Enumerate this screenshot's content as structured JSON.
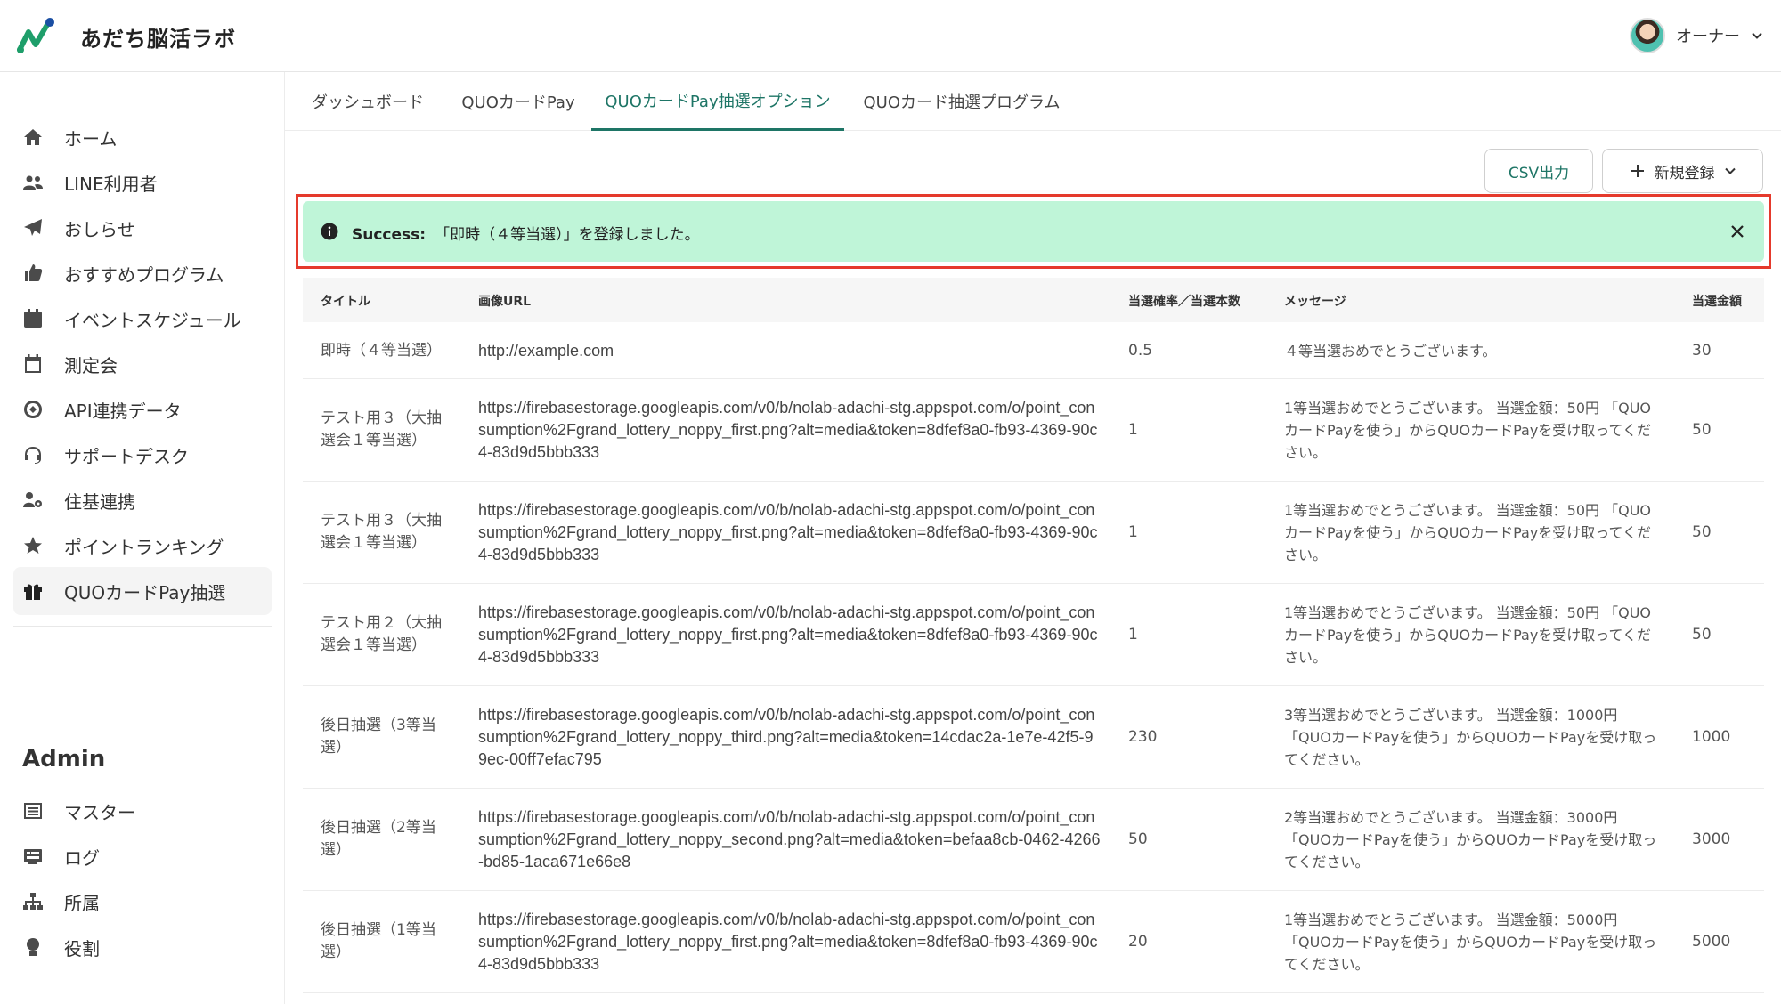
{
  "header": {
    "brand": "あだち脳活ラボ",
    "user_name": "オーナー",
    "colors": {
      "logo_green": "#1e9e6a",
      "logo_blue": "#1a4fa3",
      "accent": "#1e7566"
    }
  },
  "sidebar": {
    "items": [
      {
        "label": "ホーム",
        "icon": "home-icon"
      },
      {
        "label": "LINE利用者",
        "icon": "users-icon"
      },
      {
        "label": "おしらせ",
        "icon": "paper-plane-icon"
      },
      {
        "label": "おすすめプログラム",
        "icon": "thumbs-up-icon"
      },
      {
        "label": "イベントスケジュール",
        "icon": "calendar-icon"
      },
      {
        "label": "測定会",
        "icon": "calendar-blank-icon"
      },
      {
        "label": "API連携データ",
        "icon": "api-icon"
      },
      {
        "label": "サポートデスク",
        "icon": "headset-icon"
      },
      {
        "label": "住基連携",
        "icon": "user-gear-icon"
      },
      {
        "label": "ポイントランキング",
        "icon": "star-icon"
      },
      {
        "label": "QUOカードPay抽選",
        "icon": "gift-icon"
      }
    ],
    "admin_title": "Admin",
    "admin_items": [
      {
        "label": "マスター",
        "icon": "list-icon"
      },
      {
        "label": "ログ",
        "icon": "log-icon"
      },
      {
        "label": "所属",
        "icon": "org-icon"
      },
      {
        "label": "役割",
        "icon": "role-icon"
      }
    ]
  },
  "tabs": [
    "ダッシュボード",
    "QUOカードPay",
    "QUOカードPay抽選オプション",
    "QUOカード抽選プログラム"
  ],
  "actions": {
    "csv": "CSV出力",
    "new": "新規登録"
  },
  "alert": {
    "prefix": "Success:",
    "message": "「即時（４等当選）」を登録しました。",
    "bg_color": "#bff5d8"
  },
  "table": {
    "headers": [
      "タイトル",
      "画像URL",
      "当選確率／当選本数",
      "メッセージ",
      "当選金額"
    ],
    "rows": [
      {
        "title": "即時（４等当選）",
        "url": "http://example.com",
        "prob": "0.5",
        "message": "４等当選おめでとうございます。",
        "amount": "30"
      },
      {
        "title": "テスト用３（大抽選会１等当選）",
        "url": "https://firebasestorage.googleapis.com/v0/b/nolab-adachi-stg.appspot.com/o/point_consumption%2Fgrand_lottery_noppy_first.png?alt=media&token=8dfef8a0-fb93-4369-90c4-83d9d5bbb333",
        "prob": "1",
        "message": "1等当選おめでとうございます。 当選金額：50円 「QUOカードPayを使う」からQUOカードPayを受け取ってください。",
        "amount": "50"
      },
      {
        "title": "テスト用３（大抽選会１等当選）",
        "url": "https://firebasestorage.googleapis.com/v0/b/nolab-adachi-stg.appspot.com/o/point_consumption%2Fgrand_lottery_noppy_first.png?alt=media&token=8dfef8a0-fb93-4369-90c4-83d9d5bbb333",
        "prob": "1",
        "message": "1等当選おめでとうございます。 当選金額：50円 「QUOカードPayを使う」からQUOカードPayを受け取ってください。",
        "amount": "50"
      },
      {
        "title": "テスト用２（大抽選会１等当選）",
        "url": "https://firebasestorage.googleapis.com/v0/b/nolab-adachi-stg.appspot.com/o/point_consumption%2Fgrand_lottery_noppy_first.png?alt=media&token=8dfef8a0-fb93-4369-90c4-83d9d5bbb333",
        "prob": "1",
        "message": "1等当選おめでとうございます。 当選金額：50円 「QUOカードPayを使う」からQUOカードPayを受け取ってください。",
        "amount": "50"
      },
      {
        "title": "後日抽選（3等当選）",
        "url": "https://firebasestorage.googleapis.com/v0/b/nolab-adachi-stg.appspot.com/o/point_consumption%2Fgrand_lottery_noppy_third.png?alt=media&token=14cdac2a-1e7e-42f5-99ec-00ff7efac795",
        "prob": "230",
        "message": "3等当選おめでとうございます。 当選金額：1000円 「QUOカードPayを使う」からQUOカードPayを受け取ってください。",
        "amount": "1000"
      },
      {
        "title": "後日抽選（2等当選）",
        "url": "https://firebasestorage.googleapis.com/v0/b/nolab-adachi-stg.appspot.com/o/point_consumption%2Fgrand_lottery_noppy_second.png?alt=media&token=befaa8cb-0462-4266-bd85-1aca671e66e8",
        "prob": "50",
        "message": "2等当選おめでとうございます。 当選金額：3000円 「QUOカードPayを使う」からQUOカードPayを受け取ってください。",
        "amount": "3000"
      },
      {
        "title": "後日抽選（1等当選）",
        "url": "https://firebasestorage.googleapis.com/v0/b/nolab-adachi-stg.appspot.com/o/point_consumption%2Fgrand_lottery_noppy_first.png?alt=media&token=8dfef8a0-fb93-4369-90c4-83d9d5bbb333",
        "prob": "20",
        "message": "1等当選おめでとうございます。 当選金額：5000円 「QUOカードPayを使う」からQUOカードPayを受け取ってください。",
        "amount": "5000"
      }
    ]
  }
}
